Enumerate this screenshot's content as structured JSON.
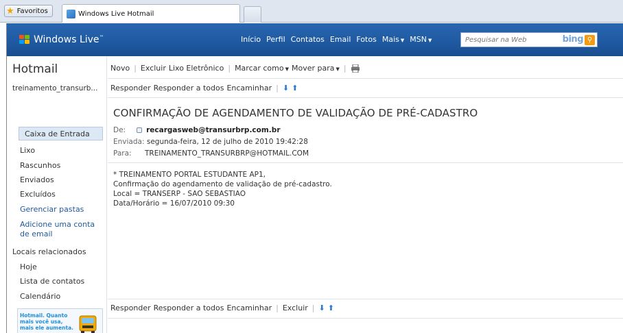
{
  "browser": {
    "favorites_label": "Favoritos",
    "active_tab_title": "Windows Live Hotmail"
  },
  "header": {
    "brand": "Windows Live",
    "brand_tm": "™",
    "nav": {
      "inicio": "Início",
      "perfil": "Perfil",
      "contatos": "Contatos",
      "email": "Email",
      "fotos": "Fotos",
      "mais": "Mais",
      "msn": "MSN"
    },
    "search_placeholder": "Pesquisar na Web",
    "bing_label": "bing"
  },
  "sidebar": {
    "title": "Hotmail",
    "account": "treinamento_transurb...",
    "folders": {
      "inbox": "Caixa de Entrada",
      "junk": "Lixo",
      "drafts": "Rascunhos",
      "sent": "Enviados",
      "deleted": "Excluídos"
    },
    "manage_folders": "Gerenciar pastas",
    "add_account": "Adicione uma conta",
    "add_account_2": "de email",
    "related_heading": "Locais relacionados",
    "related": {
      "today": "Hoje",
      "contacts": "Lista de contatos",
      "calendar": "Calendário"
    },
    "promo": {
      "line1": "Hotmail. Quanto",
      "line2": "mais você usa,",
      "line3": "mais ele aumenta."
    }
  },
  "toolbar": {
    "novo": "Novo",
    "excluir": "Excluir",
    "lixo_eletronico": "Lixo Eletrônico",
    "marcar_como": "Marcar como",
    "mover_para": "Mover para"
  },
  "reply_toolbar": {
    "responder": "Responder",
    "responder_todos": "Responder a todos",
    "encaminhar": "Encaminhar",
    "excluir": "Excluir"
  },
  "message": {
    "subject": "CONFIRMAÇÃO DE AGENDAMENTO DE VALIDAÇÃO DE PRÉ-CADASTRO",
    "from_label": "De:",
    "from": "recargasweb@transurbrp.com.br",
    "sent_label": "Enviada:",
    "sent": "segunda-feira, 12 de julho de 2010 19:42:28",
    "to_label": "Para:",
    "to": "TREINAMENTO_TRANSURBRP@HOTMAIL.COM",
    "body": {
      "line1": "* TREINAMENTO PORTAL ESTUDANTE AP1,",
      "line2": "Confirmação do agendamento de validação de pré-cadastro.",
      "line3": "Local = TRANSERP - SAO SEBASTIAO",
      "line4": "Data/Horário = 16/07/2010 09:30"
    }
  },
  "colors": {
    "header_blue": "#1f5aa2",
    "link_blue": "#1f5aa2",
    "selected_bg": "#dde8f5"
  }
}
